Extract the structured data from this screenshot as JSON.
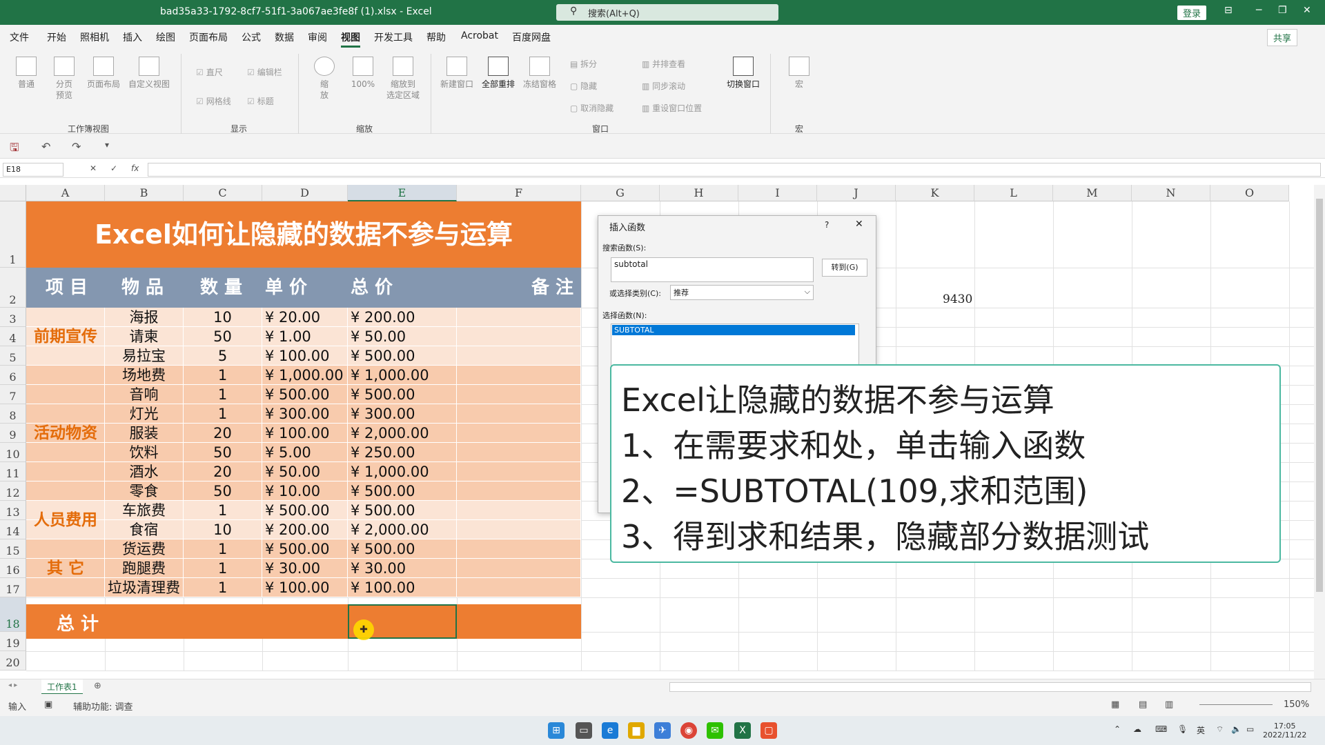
{
  "window": {
    "filename": "bad35a33-1792-8cf7-51f1-3a067ae3fe8f (1).xlsx  -  Excel",
    "search": "搜索(Alt+Q)",
    "login": "登录",
    "min": "─",
    "restore": "❐",
    "close": "✕",
    "ribbon_display": "⊟"
  },
  "menu": [
    "文件",
    "开始",
    "照相机",
    "插入",
    "绘图",
    "页面布局",
    "公式",
    "数据",
    "审阅",
    "视图",
    "开发工具",
    "帮助",
    "Acrobat",
    "百度网盘"
  ],
  "share": "共享",
  "ribbon": {
    "normal": "普通",
    "page_break": "分页\n预览",
    "page_layout": "页面布局",
    "custom_view": "自定义视图",
    "ruler": "直尺",
    "formula_bar": "编辑栏",
    "gridlines": "网格线",
    "headings": "标题",
    "zoom": "缩\n放",
    "zoom100": "100%",
    "zoom_sel": "缩放到\n选定区域",
    "new_window": "新建窗口",
    "arrange_all": "全部重排",
    "freeze": "冻结窗格",
    "split": "拆分",
    "hide": "隐藏",
    "unhide": "取消隐藏",
    "side_by_side": "并排查看",
    "sync_scroll": "同步滚动",
    "reset_pos": "重设窗口位置",
    "switch": "切换窗口",
    "macros": "宏",
    "groups": {
      "workbook": "工作簿视图",
      "show": "显示",
      "zoom": "缩放",
      "window": "窗口",
      "macro": "宏"
    }
  },
  "namebox": "E18",
  "formula_icons": [
    "✕",
    "✓",
    "fx"
  ],
  "columns": [
    "A",
    "B",
    "C",
    "D",
    "E",
    "F",
    "G",
    "H",
    "I",
    "J",
    "K",
    "L",
    "M",
    "N",
    "O"
  ],
  "rows": [
    "1",
    "2",
    "3",
    "4",
    "5",
    "6",
    "7",
    "8",
    "9",
    "10",
    "11",
    "12",
    "13",
    "14",
    "15",
    "16",
    "17",
    "18",
    "19",
    "20"
  ],
  "title": "Excel如何让隐藏的数据不参与运算",
  "headers": {
    "item": "项  目",
    "goods": "物 品",
    "qty": "数 量",
    "price": "单 价",
    "total": "总 价",
    "note": "备 注"
  },
  "categories": [
    "前期宣传",
    "活动物资",
    "人员费用",
    "其  它"
  ],
  "items": [
    [
      "海报",
      "10",
      "¥ 20.00",
      "¥ 200.00"
    ],
    [
      "请柬",
      "50",
      "¥ 1.00",
      "¥ 50.00"
    ],
    [
      "易拉宝",
      "5",
      "¥ 100.00",
      "¥ 500.00"
    ],
    [
      "场地费",
      "1",
      "¥ 1,000.00",
      "¥ 1,000.00"
    ],
    [
      "音响",
      "1",
      "¥ 500.00",
      "¥ 500.00"
    ],
    [
      "灯光",
      "1",
      "¥ 300.00",
      "¥ 300.00"
    ],
    [
      "服装",
      "20",
      "¥ 100.00",
      "¥ 2,000.00"
    ],
    [
      "饮料",
      "50",
      "¥ 5.00",
      "¥ 250.00"
    ],
    [
      "酒水",
      "20",
      "¥ 50.00",
      "¥ 1,000.00"
    ],
    [
      "零食",
      "50",
      "¥ 10.00",
      "¥ 500.00"
    ],
    [
      "车旅费",
      "1",
      "¥ 500.00",
      "¥ 500.00"
    ],
    [
      "食宿",
      "10",
      "¥ 200.00",
      "¥ 2,000.00"
    ],
    [
      "货运费",
      "1",
      "¥ 500.00",
      "¥ 500.00"
    ],
    [
      "跑腿费",
      "1",
      "¥ 30.00",
      "¥ 30.00"
    ],
    [
      "垃圾清理费",
      "1",
      "¥ 100.00",
      "¥ 100.00"
    ]
  ],
  "total_label": "总 计",
  "k2_value": "9430",
  "dialog": {
    "title": "插入函数",
    "help": "?",
    "close": "✕",
    "search_label": "搜索函数(S):",
    "search_value": "subtotal",
    "go": "转到(G)",
    "category_label": "或选择类别(C):",
    "category_value": "推荐",
    "select_label": "选择函数(N):",
    "selected_fn": "SUBTOTAL"
  },
  "overlay": [
    "Excel让隐藏的数据不参与运算",
    "1、在需要求和处，单击输入函数",
    "2、=SUBTOTAL(109,求和范围)",
    "3、得到求和结果，隐藏部分数据测试"
  ],
  "sheet_tab": "工作表1",
  "status": {
    "mode": "输入",
    "accessibility": "辅助功能: 调查",
    "zoom": "150%"
  },
  "taskbar": {
    "time": "17:05",
    "date": "2022/11/22",
    "ime": "英"
  }
}
